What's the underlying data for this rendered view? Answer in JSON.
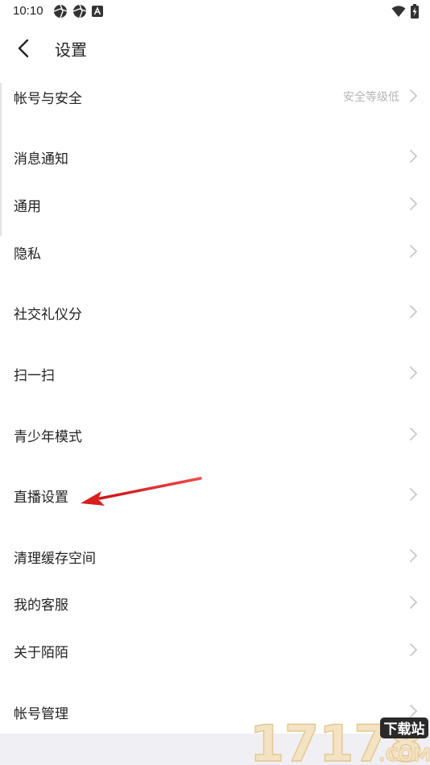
{
  "status_bar": {
    "time": "10:10",
    "left_icons": [
      "aperture-icon",
      "aperture-icon",
      "a-badge-icon"
    ],
    "right_icons": [
      "wifi-icon",
      "battery-charging-icon"
    ]
  },
  "header": {
    "title": "设置"
  },
  "settings": [
    {
      "id": "account-security",
      "label": "帐号与安全",
      "value": "安全等级低"
    },
    {
      "id": "notifications",
      "label": "消息通知",
      "value": ""
    },
    {
      "id": "general",
      "label": "通用",
      "value": ""
    },
    {
      "id": "privacy",
      "label": "隐私",
      "value": ""
    },
    {
      "id": "social-etiquette",
      "label": "社交礼仪分",
      "value": ""
    },
    {
      "id": "scan",
      "label": "扫一扫",
      "value": ""
    },
    {
      "id": "youth-mode",
      "label": "青少年模式",
      "value": ""
    },
    {
      "id": "live-settings",
      "label": "直播设置",
      "value": ""
    },
    {
      "id": "clear-cache",
      "label": "清理缓存空间",
      "value": ""
    },
    {
      "id": "customer-service",
      "label": "我的客服",
      "value": ""
    },
    {
      "id": "about",
      "label": "关于陌陌",
      "value": ""
    },
    {
      "id": "account-management",
      "label": "帐号管理",
      "value": ""
    }
  ],
  "watermark": {
    "number": "17178",
    "tagline": "下载站",
    "domain": ".COM"
  },
  "colors": {
    "text": "#222222",
    "secondary": "#b5b5b5",
    "chevron": "#c8c8c8",
    "annotation_arrow": "#e02020",
    "footer": "#efeff4"
  }
}
